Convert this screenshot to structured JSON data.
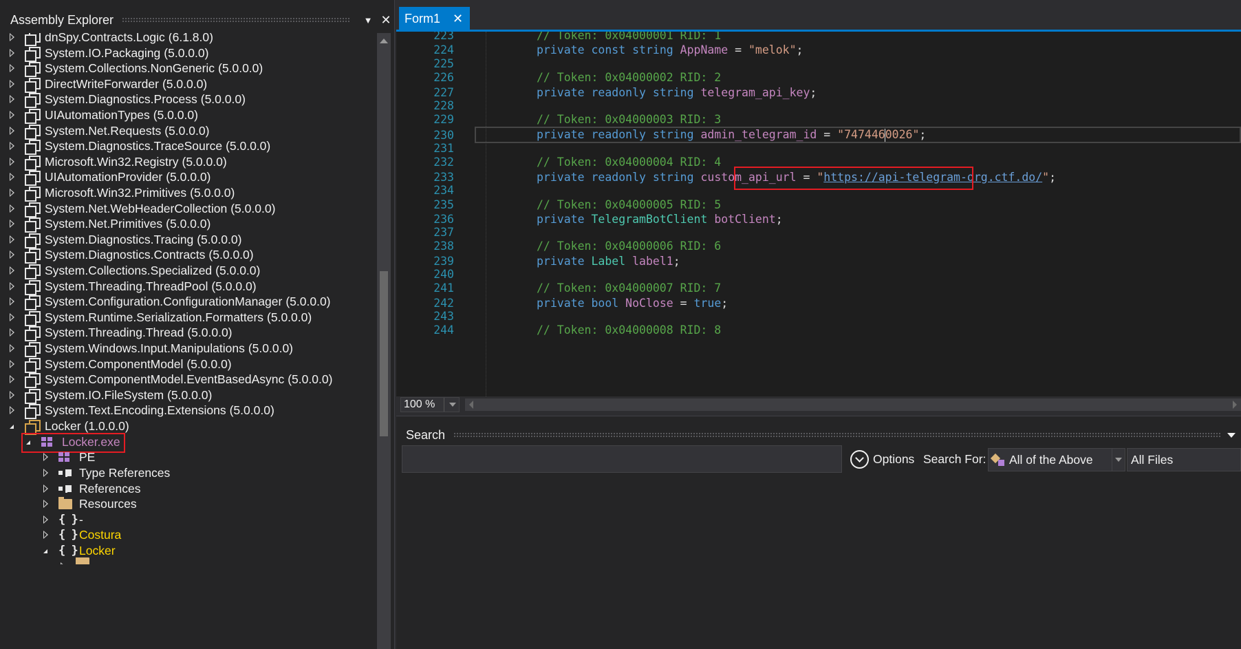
{
  "explorer": {
    "title": "Assembly Explorer",
    "items": [
      {
        "name": "dnSpy.Contracts.Logic",
        "version": "(6.1.8.0)"
      },
      {
        "name": "System.IO.Packaging",
        "version": "(5.0.0.0)"
      },
      {
        "name": "System.Collections.NonGeneric",
        "version": "(5.0.0.0)"
      },
      {
        "name": "DirectWriteForwarder",
        "version": "(5.0.0.0)"
      },
      {
        "name": "System.Diagnostics.Process",
        "version": "(5.0.0.0)"
      },
      {
        "name": "UIAutomationTypes",
        "version": "(5.0.0.0)"
      },
      {
        "name": "System.Net.Requests",
        "version": "(5.0.0.0)"
      },
      {
        "name": "System.Diagnostics.TraceSource",
        "version": "(5.0.0.0)"
      },
      {
        "name": "Microsoft.Win32.Registry",
        "version": "(5.0.0.0)"
      },
      {
        "name": "UIAutomationProvider",
        "version": "(5.0.0.0)"
      },
      {
        "name": "Microsoft.Win32.Primitives",
        "version": "(5.0.0.0)"
      },
      {
        "name": "System.Net.WebHeaderCollection",
        "version": "(5.0.0.0)"
      },
      {
        "name": "System.Net.Primitives",
        "version": "(5.0.0.0)"
      },
      {
        "name": "System.Diagnostics.Tracing",
        "version": "(5.0.0.0)"
      },
      {
        "name": "System.Diagnostics.Contracts",
        "version": "(5.0.0.0)"
      },
      {
        "name": "System.Collections.Specialized",
        "version": "(5.0.0.0)"
      },
      {
        "name": "System.Threading.ThreadPool",
        "version": "(5.0.0.0)"
      },
      {
        "name": "System.Configuration.ConfigurationManager",
        "version": "(5.0.0.0)"
      },
      {
        "name": "System.Runtime.Serialization.Formatters",
        "version": "(5.0.0.0)"
      },
      {
        "name": "System.Threading.Thread",
        "version": "(5.0.0.0)"
      },
      {
        "name": "System.Windows.Input.Manipulations",
        "version": "(5.0.0.0)"
      },
      {
        "name": "System.ComponentModel",
        "version": "(5.0.0.0)"
      },
      {
        "name": "System.ComponentModel.EventBasedAsync",
        "version": "(5.0.0.0)"
      },
      {
        "name": "System.IO.FileSystem",
        "version": "(5.0.0.0)"
      },
      {
        "name": "System.Text.Encoding.Extensions",
        "version": "(5.0.0.0)"
      }
    ],
    "locker": {
      "name": "Locker",
      "version": "(1.0.0.0)"
    },
    "locker_exe": "Locker.exe",
    "children": {
      "pe": "PE",
      "type_refs": "Type References",
      "refs": "References",
      "resources": "Resources",
      "ns_empty": "-",
      "ns_costura": "Costura",
      "ns_locker": "Locker"
    }
  },
  "editor": {
    "tab_label": "Form1",
    "tab_close": "✕",
    "lines": {
      "n223": "223",
      "n224": "224",
      "n225": "225",
      "n226": "226",
      "n227": "227",
      "n228": "228",
      "n229": "229",
      "n230": "230",
      "n231": "231",
      "n232": "232",
      "n233": "233",
      "n234": "234",
      "n235": "235",
      "n236": "236",
      "n237": "237",
      "n238": "238",
      "n239": "239",
      "n240": "240",
      "n241": "241",
      "n242": "242",
      "n243": "243",
      "n244": "244"
    },
    "comments": {
      "c223": "// Token: 0x04000001 RID: 1",
      "c226": "// Token: 0x04000002 RID: 2",
      "c229": "// Token: 0x04000003 RID: 3",
      "c232": "// Token: 0x04000004 RID: 4",
      "c235": "// Token: 0x04000005 RID: 5",
      "c238": "// Token: 0x04000006 RID: 6",
      "c241": "// Token: 0x04000007 RID: 7",
      "c244": "// Token: 0x04000008 RID: 8"
    },
    "kw": {
      "private": "private",
      "const": "const",
      "string": "string",
      "readonly": "readonly",
      "bool": "bool",
      "true": "true"
    },
    "fields": {
      "app_name": "AppName",
      "api_key": "telegram_api_key",
      "admin_id": "admin_telegram_id",
      "custom_url": "custom_api_url",
      "bot_client": "botClient",
      "label1": "label1",
      "no_close": "NoClose"
    },
    "types": {
      "bot_client_type": "TelegramBotClient",
      "label_type": "Label"
    },
    "strings": {
      "melok": "\"melok\"",
      "admin_id_a": "\"747446",
      "admin_id_b": "0026\"",
      "url_quote": "\"",
      "url": "https://api-telegram-org.ctf.do/"
    },
    "punct": {
      "assign": " = ",
      "semi": ";"
    },
    "zoom": "100 %"
  },
  "search": {
    "title": "Search",
    "input_value": "",
    "options_label": "Options",
    "search_for_label": "Search For:",
    "search_for_value": "All of the Above",
    "files_value": "All Files"
  },
  "colors": {
    "accent": "#007acc",
    "highlight_box": "#e51c23",
    "comment": "#57a64a",
    "keyword": "#569cd6",
    "field": "#c586c0",
    "string": "#d69d85",
    "type": "#4ec9b0"
  }
}
